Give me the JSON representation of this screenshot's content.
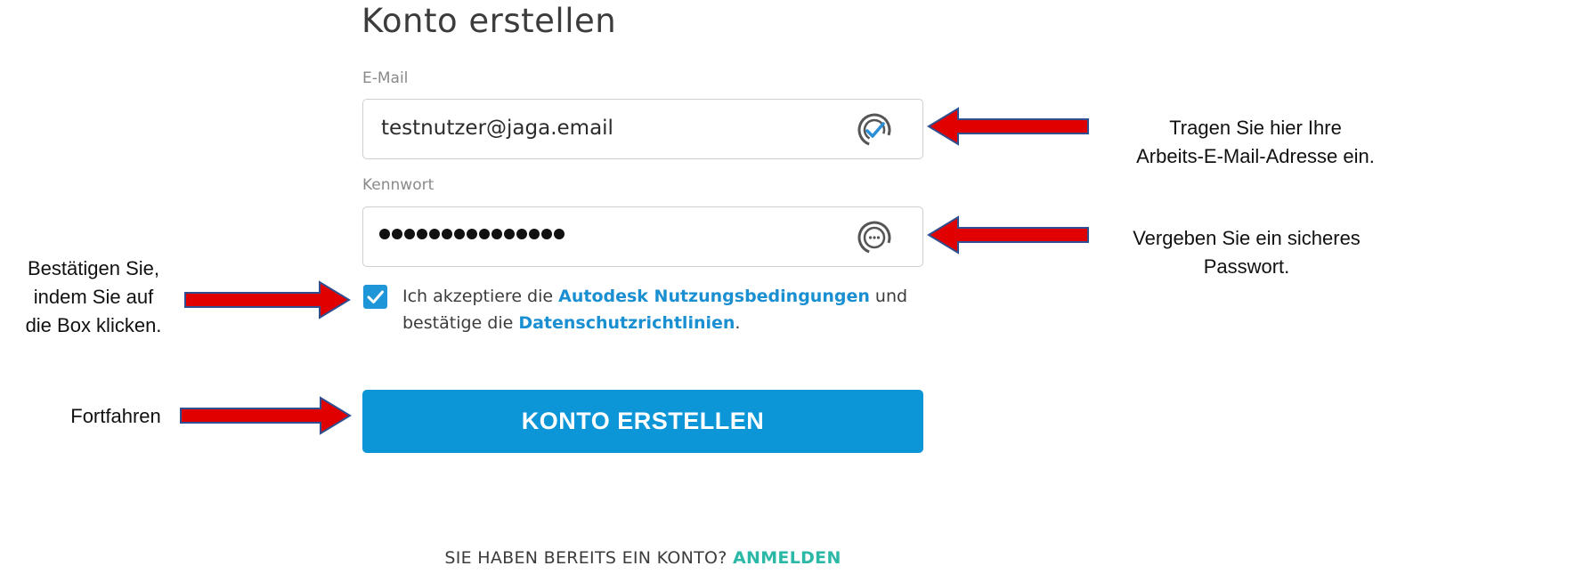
{
  "form": {
    "title": "Konto erstellen",
    "email_label": "E-Mail",
    "email_value": "testnutzer@jaga.email",
    "password_label": "Kennwort",
    "password_dot_count": 15,
    "terms": {
      "checked": true,
      "prefix": "Ich akzeptiere die ",
      "terms_link": "Autodesk Nutzungsbedingungen",
      "middle": " und bestätige die ",
      "privacy_link": "Datenschutzrichtlinien",
      "suffix": "."
    },
    "submit_label": "KONTO ERSTELLEN",
    "signin_prompt": "SIE HABEN BEREITS EIN KONTO? ",
    "signin_link": "ANMELDEN"
  },
  "annotations": {
    "email_hint_line1": "Tragen Sie hier Ihre",
    "email_hint_line2": "Arbeits-E-Mail-Adresse ein.",
    "password_hint_line1": "Vergeben Sie ein sicheres",
    "password_hint_line2": "Passwort.",
    "checkbox_hint_line1": "Bestätigen Sie,",
    "checkbox_hint_line2": "indem Sie auf",
    "checkbox_hint_line3": "die Box klicken.",
    "continue_hint": "Fortfahren"
  },
  "icons": {
    "email_field": "password-manager-check-icon",
    "password_field": "password-manager-dots-icon",
    "checkbox": "checkmark-icon",
    "annotation_arrows": "red-arrow-icon"
  },
  "colors": {
    "primary_button": "#0c96d8",
    "link_blue": "#1a8fd1",
    "signin_link": "#2bb8a6",
    "arrow_fill": "#e00000",
    "arrow_stroke": "#2f4f8f"
  }
}
